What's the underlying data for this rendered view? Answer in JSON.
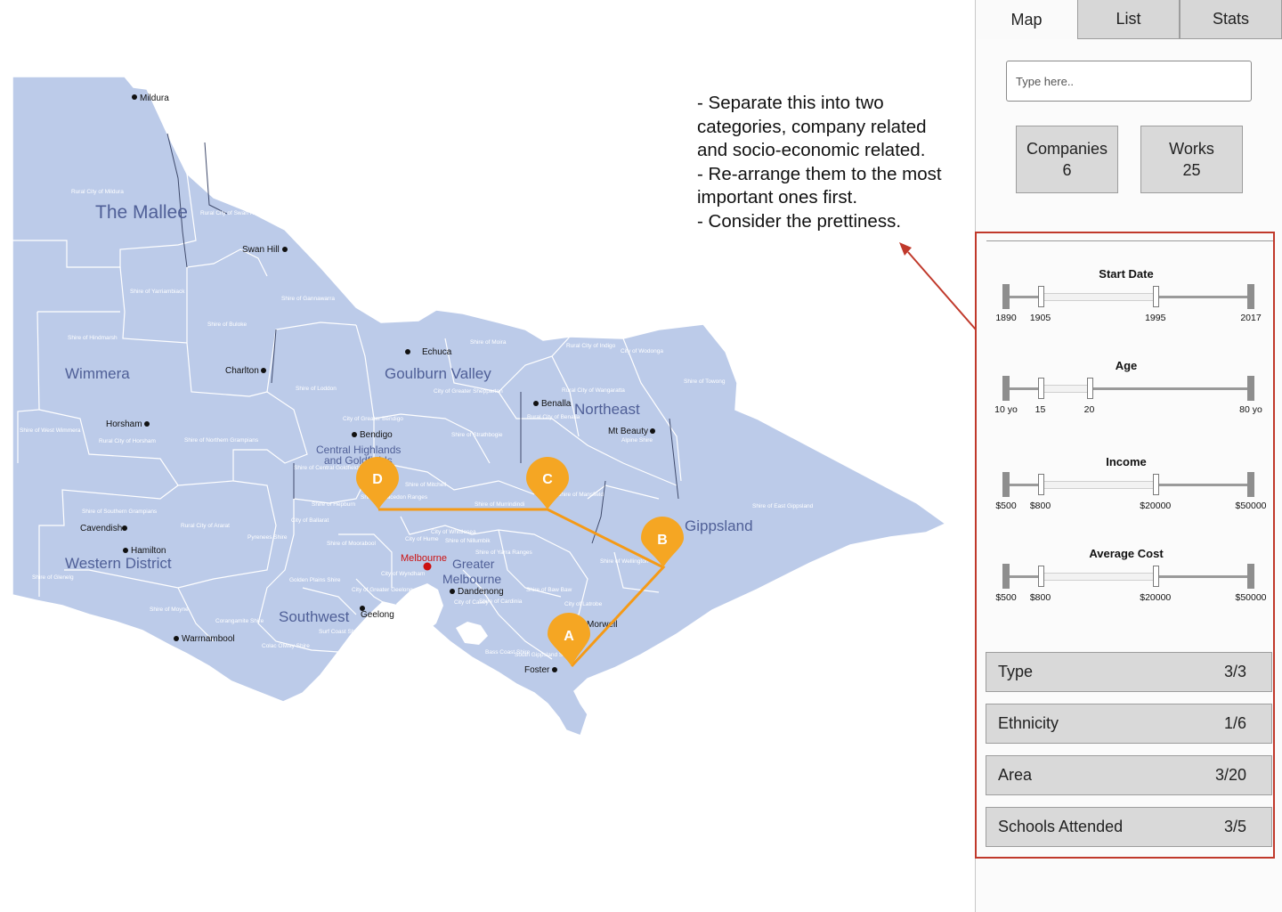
{
  "map": {
    "regions": [
      "The Mallee",
      "Wimmera",
      "Goulburn Valley",
      "Northeast",
      "Central Highlands",
      "and Goldfields",
      "Gippsland",
      "Western District",
      "Greater",
      "Melbourne",
      "Southwest"
    ],
    "towns": [
      "Mildura",
      "Swan Hill",
      "Echuca",
      "Charlton",
      "Benalla",
      "Horsham",
      "Bendigo",
      "Mt Beauty",
      "Cavendish",
      "Hamilton",
      "Melbourne",
      "Dandenong",
      "Geelong",
      "Warrnambool",
      "Morwell",
      "Foster"
    ],
    "shires": [
      "Rural City of Mildura",
      "Rural City of Swan Hill",
      "Shire of Yarriambiack",
      "Shire of Gannawarra",
      "Shire of Hindmarsh",
      "Shire of Buloke",
      "Shire of Moira",
      "Rural City of Indigo",
      "City of Wodonga",
      "Shire of Loddon",
      "City of Greater Shepparton",
      "Rural City of Wangaratta",
      "Shire of Towong",
      "Shire of West Wimmera",
      "Rural City of Horsham",
      "Shire of Northern Grampians",
      "City of Greater Bendigo",
      "Shire of Strathbogie",
      "Rural City of Benalla",
      "Alpine Shire",
      "Shire of Central Goldfields",
      "Shire of Mitchell",
      "Shire of Mansfield",
      "Shire of Murrindindi",
      "Shire of East Gippsland",
      "Shire of Southern Grampians",
      "Rural City of Ararat",
      "Pyrenees Shire",
      "City of Ballarat",
      "Shire of Hepburn",
      "Shire of Macedon Ranges",
      "Shire of Moorabool",
      "City of Hume",
      "City of Whittlesea",
      "Shire of Nillumbik",
      "Shire of Yarra Ranges",
      "Shire of Wellington",
      "Shire of Glenelg",
      "Golden Plains Shire",
      "City of Greater Geelong",
      "City of Wyndham",
      "Shire of Baw Baw",
      "City of Latrobe",
      "Shire of Cardinia",
      "City of Casey",
      "Shire of Moyne",
      "Corangamite Shire",
      "Colac Otway Shire",
      "Surf Coast Shire",
      "Bass Coast Shire",
      "South Gippsland Shire"
    ],
    "markers": [
      "A",
      "B",
      "C",
      "D"
    ]
  },
  "annotation": {
    "lines": [
      "- Separate this into two",
      "categories, company related",
      "and socio-economic related.",
      "- Re-arrange them to the most",
      "important ones first.",
      "- Consider the prettiness."
    ]
  },
  "tabs": [
    "Map",
    "List",
    "Stats"
  ],
  "search": {
    "placeholder": "Type here.."
  },
  "stats": [
    {
      "label": "Companies",
      "value": "6"
    },
    {
      "label": "Works",
      "value": "25"
    }
  ],
  "sliders": [
    {
      "title": "Start Date",
      "min": "1890",
      "low": "1905",
      "high": "1995",
      "max": "2017",
      "low_frac": 0.14,
      "high_frac": 0.61
    },
    {
      "title": "Age",
      "min": "10 yo",
      "low": "15",
      "high": "20",
      "max": "80 yo",
      "low_frac": 0.14,
      "high_frac": 0.34
    },
    {
      "title": "Income",
      "min": "$500",
      "low": "$800",
      "high": "$20000",
      "max": "$50000",
      "low_frac": 0.14,
      "high_frac": 0.61
    },
    {
      "title": "Average Cost",
      "min": "$500",
      "low": "$800",
      "high": "$20000",
      "max": "$50000",
      "low_frac": 0.14,
      "high_frac": 0.61
    }
  ],
  "filters": [
    {
      "label": "Type",
      "value": "3/3"
    },
    {
      "label": "Ethnicity",
      "value": "1/6"
    },
    {
      "label": "Area",
      "value": "3/20"
    },
    {
      "label": "Schools Attended",
      "value": "3/5"
    }
  ],
  "colors": {
    "map_fill": "#bccbe9",
    "map_stroke": "#ffffff",
    "marker": "#f5a623",
    "route": "#f59a16",
    "highlight_border": "#c0392b",
    "melbourne": "#cc1111"
  }
}
